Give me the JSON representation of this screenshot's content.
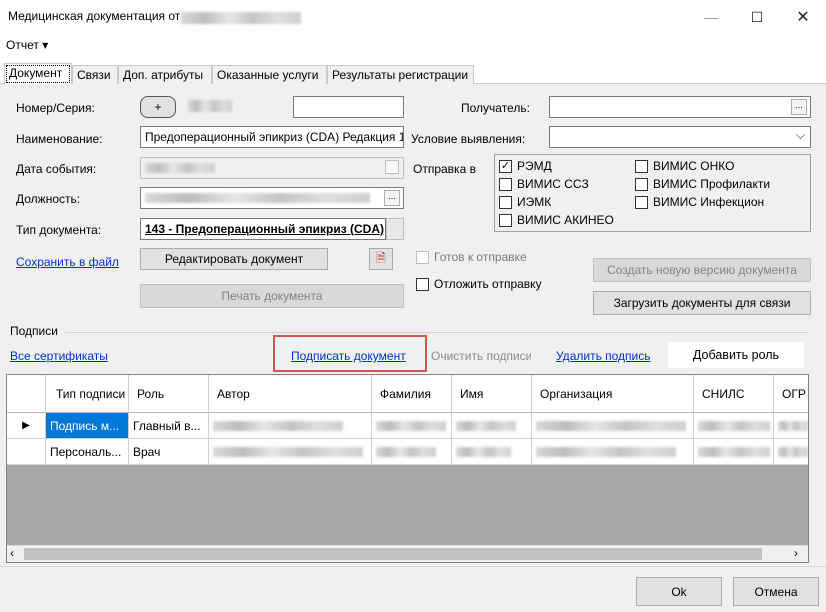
{
  "window": {
    "title": "Медицинская документация от"
  },
  "menu": {
    "report": "Отчет ▾"
  },
  "tabs": [
    "Документ",
    "Связи",
    "Доп. атрибуты",
    "Оказанные услуги",
    "Результаты регистрации"
  ],
  "form": {
    "number_label": "Номер/Серия:",
    "plus_label": "+",
    "name_label": "Наименование:",
    "name_value": "Предоперационный эпикриз (CDA) Редакция 1",
    "event_date_label": "Дата события:",
    "position_label": "Должность:",
    "doc_type_label": "Тип документа:",
    "doc_type_value": "143 - Предоперационный эпикриз (CDA)",
    "recipient_label": "Получатель:",
    "condition_label": "Условие выявления:",
    "send_to_label": "Отправка в",
    "send_targets": [
      "РЭМД",
      "ВИМИС ОНКО",
      "ВИМИС ССЗ",
      "ВИМИС Профилакти",
      "ИЭМК",
      "ВИМИС Инфекцион",
      "ВИМИС АКИНЕО"
    ],
    "rmd_checked": true,
    "save_to_file": "Сохранить в файл",
    "edit_document": "Редактировать документ",
    "print_document": "Печать документа",
    "ready_to_send": "Готов к отправке",
    "postpone_send": "Отложить отправку",
    "new_version": "Создать новую версию документа",
    "upload_for_link": "Загрузить документы для связи"
  },
  "signatures": {
    "section_label": "Подписи",
    "all_certificates": "Все сертификаты",
    "sign_document": "Подписать документ",
    "clear_signatures": "Очистить подписи",
    "delete_signature": "Удалить подпись",
    "add_role": "Добавить роль",
    "columns": [
      "Тип подписи",
      "Роль",
      "Автор",
      "Фамилия",
      "Имя",
      "Организация",
      "СНИЛС",
      "ОГР"
    ],
    "rows": [
      {
        "type": "Подпись м...",
        "role": "Главный в...",
        "selected": true
      },
      {
        "type": "Персональ...",
        "role": "Врач",
        "selected": false
      }
    ]
  },
  "footer": {
    "ok": "Ok",
    "cancel": "Отмена"
  },
  "colors": {
    "highlight_box": "#d9534f",
    "link": "#0033cc",
    "selection": "#0078d7"
  },
  "icons": [
    "minimize-icon",
    "maximize-icon",
    "close-icon",
    "dropdown-chevron-icon",
    "ellipsis-icon",
    "document-icon",
    "row-pointer-icon",
    "scroll-left-icon",
    "scroll-right-icon"
  ]
}
